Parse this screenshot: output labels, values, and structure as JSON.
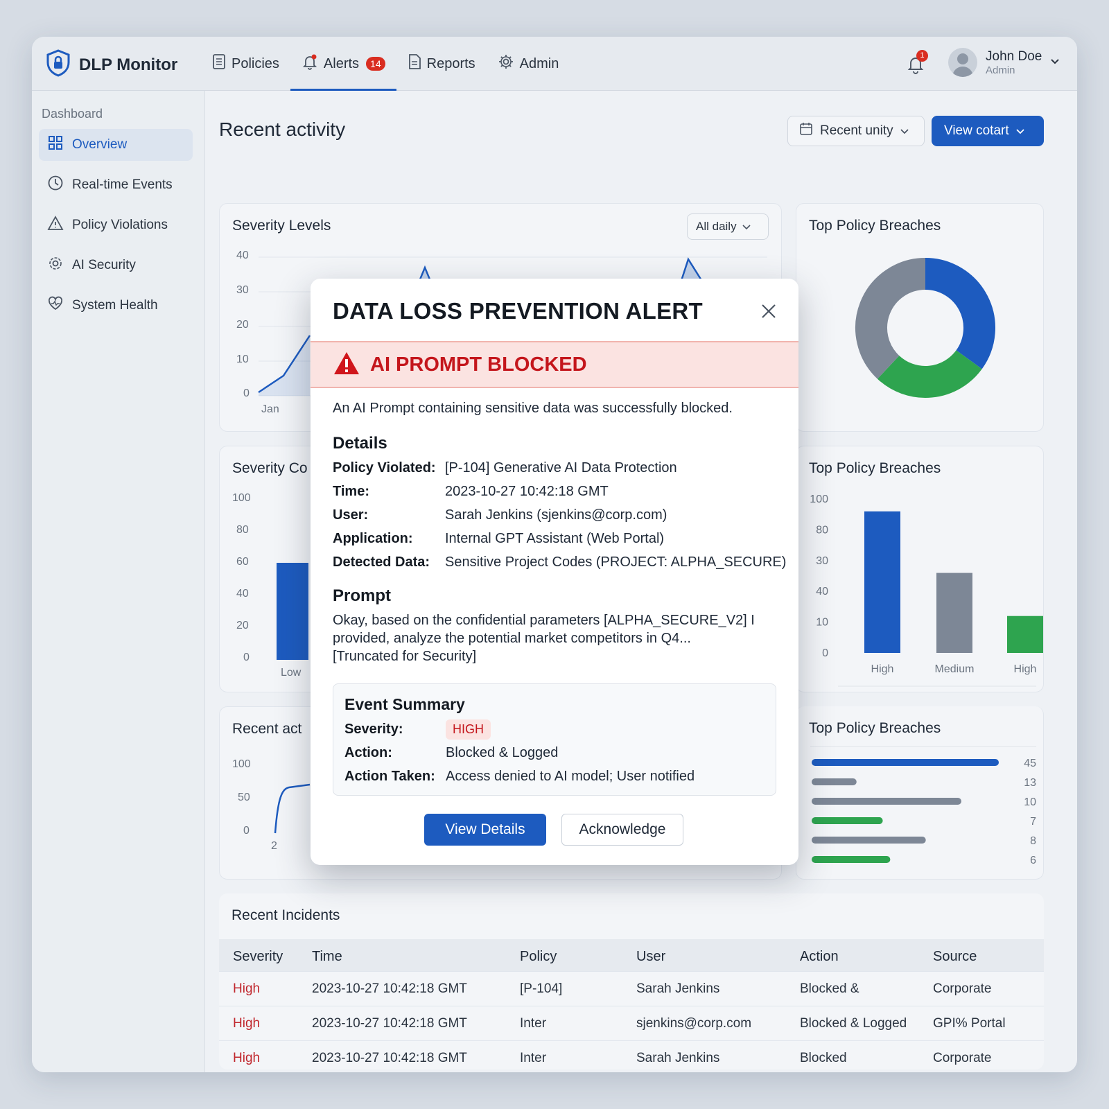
{
  "app": {
    "name": "DLP Monitor"
  },
  "nav": {
    "items": [
      {
        "label": "Policies",
        "icon": "document-list-icon"
      },
      {
        "label": "Alerts",
        "icon": "bell-icon",
        "badge": "14"
      },
      {
        "label": "Reports",
        "icon": "report-icon"
      },
      {
        "label": "Admin",
        "icon": "gear-icon"
      }
    ],
    "active": "Alerts"
  },
  "notifications": {
    "count": "1"
  },
  "user": {
    "name": "John Doe",
    "role": "Admin"
  },
  "sidebar": {
    "title": "Dashboard",
    "items": [
      {
        "label": "Overview",
        "icon": "grid-icon"
      },
      {
        "label": "Real-time Events",
        "icon": "clock-icon"
      },
      {
        "label": "Policy Violations",
        "icon": "warning-icon"
      },
      {
        "label": "AI Security",
        "icon": "gear-icon"
      },
      {
        "label": "System Health",
        "icon": "heart-pulse-icon"
      }
    ]
  },
  "main": {
    "title": "Recent activity",
    "filter_label": "Recent unity",
    "primary_label": "View cotart"
  },
  "cards": {
    "severity_levels": {
      "title": "Severity Levels",
      "select": "All daily",
      "y_ticks": [
        "40",
        "30",
        "20",
        "10",
        "0"
      ],
      "x_first": "Jan"
    },
    "top_breaches_donut": {
      "title": "Top Policy Breaches"
    },
    "severity_counts": {
      "title": "Severity Co",
      "y_ticks": [
        "100",
        "80",
        "60",
        "40",
        "20",
        "0"
      ],
      "x_first": "Low"
    },
    "top_breaches_bar": {
      "title": "Top Policy Breaches",
      "y_ticks": [
        "100",
        "80",
        "30",
        "40",
        "10",
        "0"
      ]
    },
    "recent_activity": {
      "title": "Recent act",
      "y_ticks": [
        "100",
        "50",
        "0"
      ],
      "x_first": "2"
    },
    "top_breaches_hbar": {
      "title": "Top Policy Breaches"
    }
  },
  "chart_data": [
    {
      "type": "line",
      "title": "Severity Levels",
      "ylim": [
        0,
        40
      ],
      "x": [
        "Jan"
      ],
      "note_values_visible_only_partially": true,
      "series": [
        {
          "values": [
            1,
            5,
            14
          ]
        }
      ]
    },
    {
      "type": "pie",
      "title": "Top Policy Breaches",
      "slices": [
        {
          "value": 35,
          "color": "#1d5bbf"
        },
        {
          "value": 27,
          "color": "#2ea44f"
        },
        {
          "value": 38,
          "color": "#7d8796"
        }
      ]
    },
    {
      "type": "bar",
      "title": "Top Policy Breaches",
      "categories": [
        "High",
        "Medium",
        "High"
      ],
      "values": [
        92,
        52,
        24
      ],
      "colors": [
        "#1d5bbf",
        "#7d8796",
        "#2ea44f"
      ],
      "y_tick_labels": [
        "0",
        "10",
        "40",
        "30",
        "80",
        "100"
      ]
    },
    {
      "type": "bar",
      "title": "Top Policy Breaches",
      "orientation": "horizontal",
      "values": [
        45,
        13,
        10,
        7,
        8,
        6
      ],
      "colors": [
        "#1d5bbf",
        "#7d8796",
        "#7d8796",
        "#2ea44f",
        "#7d8796",
        "#2ea44f"
      ],
      "bar_fraction": [
        1.0,
        0.24,
        0.8,
        0.38,
        0.61,
        0.42
      ]
    }
  ],
  "modal": {
    "title": "DATA LOSS PREVENTION ALERT",
    "banner": "AI PROMPT BLOCKED",
    "intro": "An AI Prompt containing sensitive data was successfully blocked.",
    "details_heading": "Details",
    "details": [
      {
        "label": "Policy Violated:",
        "value": "[P-104] Generative AI Data Protection"
      },
      {
        "label": "Time:",
        "value": "2023-10-27 10:42:18 GMT"
      },
      {
        "label": "User:",
        "value": "Sarah Jenkins (sjenkins@corp.com)"
      },
      {
        "label": "Application:",
        "value": "Internal GPT Assistant (Web Portal)"
      },
      {
        "label": "Detected Data:",
        "value": "Sensitive Project Codes (PROJECT: ALPHA_SECURE)"
      }
    ],
    "prompt_heading": "Prompt",
    "prompt_lines": [
      "Okay, based on the confidential parameters [ALPHA_SECURE_V2] I",
      "provided, analyze the potential market competitors in Q4...",
      "[Truncated for Security]"
    ],
    "summary": {
      "heading": "Event Summary",
      "severity_label": "Severity:",
      "severity_value": "HIGH",
      "action_label": "Action:",
      "action_value": "Blocked & Logged",
      "taken_label": "Action Taken:",
      "taken_value": "Access denied to AI model; User notified"
    },
    "view_details": "View Details",
    "acknowledge": "Acknowledge"
  },
  "incidents": {
    "title": "Recent Incidents",
    "columns": [
      "Severity",
      "Time",
      "Policy",
      "User",
      "Action",
      "Source"
    ],
    "rows": [
      [
        "High",
        "2023-10-27 10:42:18 GMT",
        "[P-104]",
        "Sarah Jenkins",
        "Blocked &",
        "Corporate"
      ],
      [
        "High",
        "2023-10-27 10:42:18 GMT",
        "Inter",
        "sjenkins@corp.com",
        "Blocked & Logged",
        "GPI% Portal"
      ],
      [
        "High",
        "2023-10-27 10:42:18 GMT",
        "Inter",
        "Sarah Jenkins",
        "Blocked",
        "Corporate"
      ]
    ]
  }
}
